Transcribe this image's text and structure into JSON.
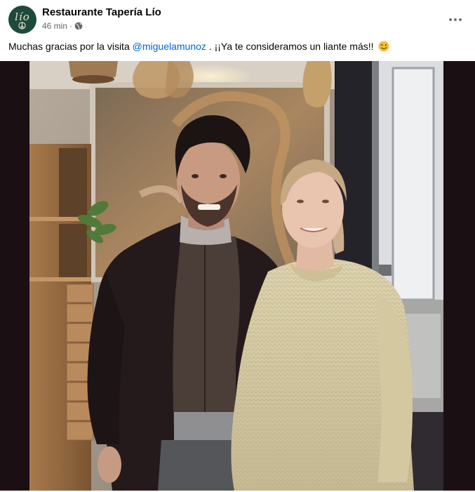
{
  "post": {
    "author": "Restaurante Tapería Lío",
    "avatar_text": "lío",
    "time": "46 min",
    "separator": "·",
    "privacy_icon": "globe-icon",
    "more_icon": "more-horizontal-icon",
    "caption": {
      "before_mention": "Muchas gracias por la visita ",
      "mention": "@miguelamunoz",
      "after_mention": " . ¡¡Ya te consideramos un liante más!!",
      "emoji": "wink-emoji"
    }
  },
  "colors": {
    "avatar_bg": "#1e4a3c",
    "mention": "#0064d1",
    "meta": "#65676b",
    "photo_frame": "#1a0f12"
  }
}
